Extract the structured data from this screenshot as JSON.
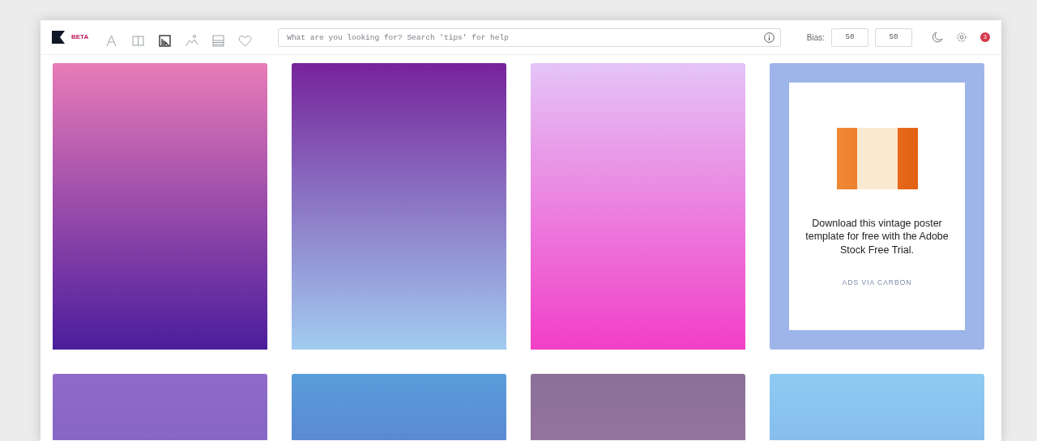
{
  "toolbar": {
    "logo_badge": "BETA",
    "tools": [
      {
        "kind": "font",
        "selected": false
      },
      {
        "kind": "columns",
        "selected": false
      },
      {
        "kind": "chart",
        "selected": true
      },
      {
        "kind": "image",
        "selected": false
      },
      {
        "kind": "lines",
        "selected": false
      },
      {
        "kind": "heart",
        "selected": false
      }
    ],
    "search": {
      "placeholder": "What are you looking for? Search 'tips' for help"
    },
    "bias_label": "Bias:",
    "bias_values": [
      "50",
      "50"
    ],
    "notification_count": "3"
  },
  "grid": [
    {
      "kind": "gradient",
      "stops": [
        {
          "color": "#e87bb8"
        },
        {
          "color": "#4b1d9c"
        }
      ]
    },
    {
      "kind": "gradient",
      "stops": [
        {
          "color": "#76239a"
        },
        {
          "color": "#a2ccf1"
        }
      ]
    },
    {
      "kind": "gradient",
      "stops": [
        {
          "color": "#e4c4f7"
        },
        {
          "color": "#f23fc7"
        }
      ]
    },
    {
      "kind": "ad",
      "text": "Download this vintage poster template for free with the Adobe Stock Free Trial.",
      "credit": "ADS VIA CARBON"
    },
    {
      "kind": "gradient",
      "stops": [
        {
          "color": "#8f6ac9"
        },
        {
          "color": "#8866c6"
        }
      ]
    },
    {
      "kind": "gradient",
      "stops": [
        {
          "color": "#5a9ddb"
        },
        {
          "color": "#5a8ad2"
        }
      ]
    },
    {
      "kind": "gradient",
      "stops": [
        {
          "color": "#8a7099"
        },
        {
          "color": "#94739f"
        }
      ]
    },
    {
      "kind": "gradient",
      "stops": [
        {
          "color": "#8ecbf1"
        },
        {
          "color": "#86bdee"
        }
      ]
    }
  ]
}
